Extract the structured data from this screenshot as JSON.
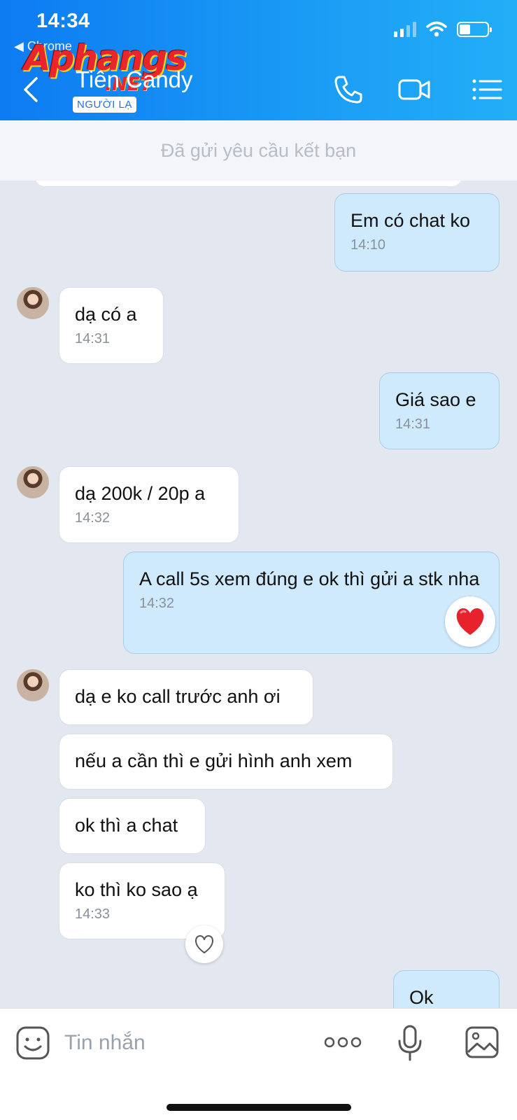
{
  "status_bar": {
    "time": "14:34",
    "back_app": "◀ Chrome"
  },
  "watermark": {
    "main": "Aphangs",
    "suffix": ".NET"
  },
  "header": {
    "contact_name": "Tiên Candy",
    "badge": "NGƯỜI LẠ"
  },
  "friend_request": {
    "text": "Đã gửi yêu cầu kết bạn"
  },
  "messages": [
    {
      "dir": "out",
      "text": "Em có chat ko",
      "time": "14:10"
    },
    {
      "dir": "in",
      "text": "dạ có a",
      "time": "14:31"
    },
    {
      "dir": "out",
      "text": "Giá sao e",
      "time": "14:31"
    },
    {
      "dir": "in",
      "text": "dạ 200k / 20p a",
      "time": "14:32"
    },
    {
      "dir": "out",
      "text": "A call 5s xem đúng e ok thì gửi a stk nha",
      "time": "14:32",
      "reaction": "heart-filled"
    },
    {
      "dir": "in",
      "text": "dạ e ko call trước anh ơi"
    },
    {
      "dir": "in",
      "text": "nếu a cần thì e gửi hình anh xem"
    },
    {
      "dir": "in",
      "text": "ok thì a chat"
    },
    {
      "dir": "in",
      "text": "ko thì ko sao ạ",
      "time": "14:33",
      "reaction": "heart-outline"
    },
    {
      "dir": "out",
      "text": "Ok"
    }
  ],
  "input": {
    "placeholder": "Tin nhắn"
  },
  "colors": {
    "header": "#1a9cf5",
    "out_bubble": "#cfeafd",
    "in_bubble": "#ffffff",
    "chat_bg": "#e3e7f0",
    "heart": "#e8222c"
  }
}
